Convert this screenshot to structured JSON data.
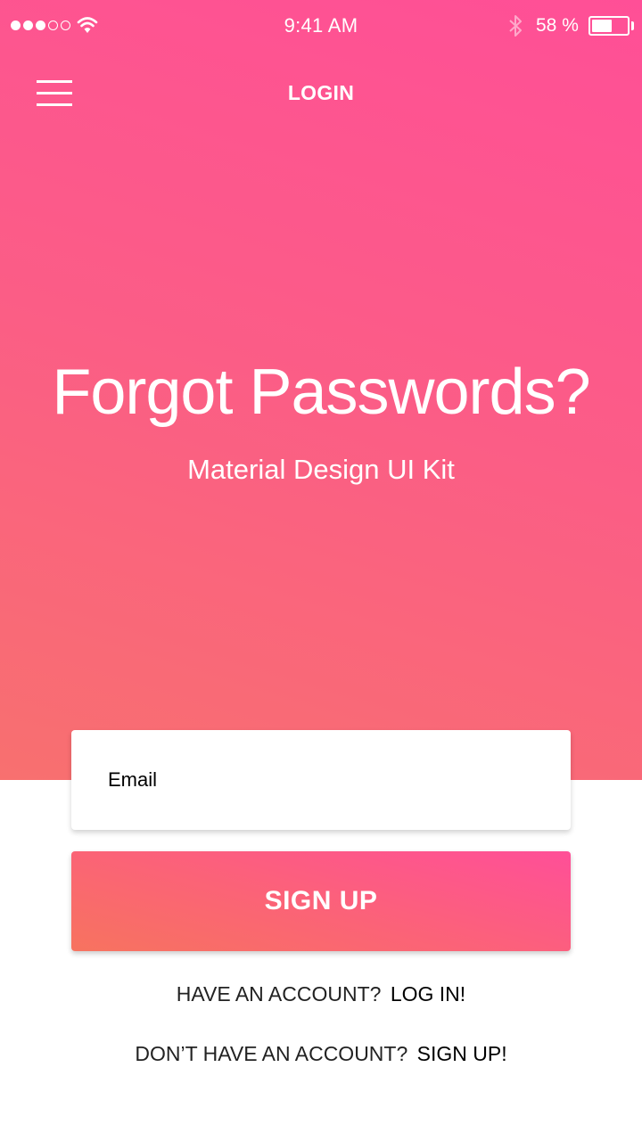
{
  "status_bar": {
    "time": "9:41 AM",
    "battery_percent_label": "58 %",
    "battery_level": 0.58,
    "signal_bars_filled": 3,
    "signal_bars_total": 5,
    "icons": [
      "signal-dots-icon",
      "wifi-icon",
      "bluetooth-icon",
      "battery-icon"
    ]
  },
  "header": {
    "title": "LOGIN",
    "menu_icon": "hamburger-menu-icon"
  },
  "hero": {
    "title": "Forgot Passwords?",
    "subtitle": "Material Design UI Kit"
  },
  "form": {
    "email_placeholder": "Email",
    "email_value": "",
    "submit_label": "SIGN UP"
  },
  "links": {
    "have_account_text": "HAVE AN ACCOUNT?",
    "login_link": "LOG IN!",
    "no_account_text": "DON’T HAVE AN ACCOUNT?",
    "signup_link": "SIGN UP!"
  },
  "colors": {
    "gradient_top": "#ff4f97",
    "gradient_bottom": "#f8706f",
    "text_on_accent": "#ffffff",
    "background": "#ffffff"
  }
}
